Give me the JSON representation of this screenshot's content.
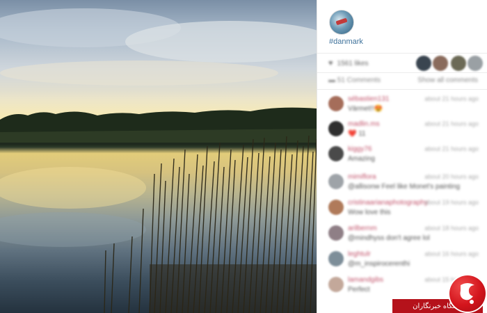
{
  "post": {
    "hashtag": "#danmark",
    "likes_text": "1561 likes",
    "comments_count_text": "51 Comments",
    "show_all_text": "Show all comments"
  },
  "comments": [
    {
      "user": "sébastien131",
      "time": "about 21 hours ago",
      "text": "Värmet!!😍"
    },
    {
      "user": "madlin.ms",
      "time": "about 21 hours ago",
      "text": "❤️ 11"
    },
    {
      "user": "kiggy76",
      "time": "about 21 hours ago",
      "text": "Amazing"
    },
    {
      "user": "mimiflora",
      "time": "about 20 hours ago",
      "text": "@allisonw Feel like Monet's painting"
    },
    {
      "user": "cristinaarianaphotography",
      "time": "about 19 hours ago",
      "text": "Wow love this"
    },
    {
      "user": "arilbernm",
      "time": "about 18 hours ago",
      "text": "@mindhyss don't agree lol"
    },
    {
      "user": "leghtulr",
      "time": "about 16 hours ago",
      "text": "@m_inspirocerenthi"
    },
    {
      "user": "lamandgibs",
      "time": "about 15 hours ago",
      "text": "Perfect"
    }
  ],
  "watermark": {
    "label": "باشگاه خبرنگاران"
  },
  "colors": {
    "username": "#c2536b",
    "mention": "#3f729b",
    "watermark_red": "#b5121b"
  }
}
